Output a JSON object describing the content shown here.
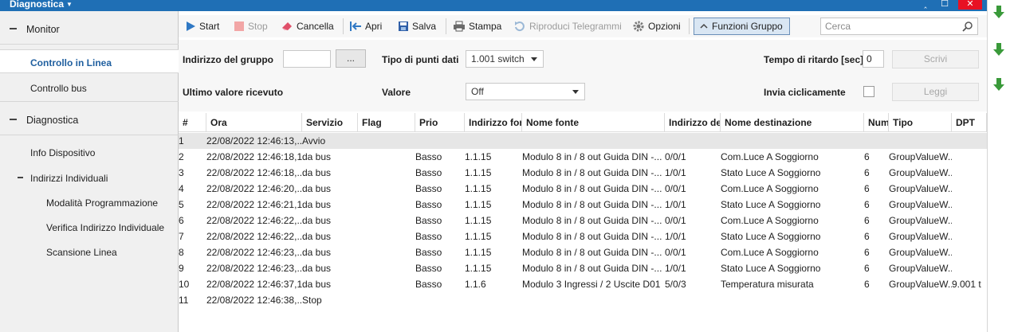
{
  "app": {
    "title": "Diagnostica"
  },
  "window_controls": {
    "minimize": "‸",
    "maximize": "☐",
    "close": "✕"
  },
  "sidebar": {
    "sections": [
      {
        "label": "Monitor"
      },
      {
        "label": "Diagnostica"
      }
    ],
    "items": [
      {
        "label": "Controllo in Linea"
      },
      {
        "label": "Controllo bus"
      },
      {
        "label": "Info Dispositivo"
      },
      {
        "label": "Indirizzi Individuali"
      },
      {
        "label": "Modalità Programmazione"
      },
      {
        "label": "Verifica Indirizzo Individuale"
      },
      {
        "label": "Scansione Linea"
      }
    ]
  },
  "toolbar": {
    "start": "Start",
    "stop": "Stop",
    "cancel": "Cancella",
    "open": "Apri",
    "save": "Salva",
    "print": "Stampa",
    "replay": "Riproduci Telegrammi",
    "options": "Opzioni",
    "group_functions": "Funzioni Gruppo",
    "search_placeholder": "Cerca"
  },
  "form": {
    "group_address_label": "Indirizzo del gruppo",
    "group_address_value": "",
    "browse_label": "...",
    "dpt_label": "Tipo di punti dati",
    "dpt_value": "1.001 switch",
    "delay_label": "Tempo di ritardo [sec]",
    "delay_value": "0",
    "write_label": "Scrivi",
    "last_value_label": "Ultimo valore ricevuto",
    "value_label": "Valore",
    "value_value": "Off",
    "cyclic_label": "Invia ciclicamente",
    "read_label": "Leggi"
  },
  "grid": {
    "columns": [
      "#",
      "Ora",
      "Servizio",
      "Flag",
      "Prio",
      "Indirizzo fonte",
      "Nome fonte",
      "Indirizzo destinazione",
      "Nome destinazione",
      "Num",
      "Tipo",
      "DPT"
    ],
    "rows": [
      [
        "1",
        "22/08/2022 12:46:13,...",
        "Avvio",
        "",
        "",
        "",
        "",
        "",
        "",
        "",
        "",
        ""
      ],
      [
        "2",
        "22/08/2022 12:46:18,1...",
        "da bus",
        "",
        "Basso",
        "1.1.15",
        "Modulo 8 in / 8 out Guida DIN -...",
        "0/0/1",
        "Com.Luce A Soggiorno",
        "6",
        "GroupValueW...",
        ""
      ],
      [
        "3",
        "22/08/2022 12:46:18,...",
        "da bus",
        "",
        "Basso",
        "1.1.15",
        "Modulo 8 in / 8 out Guida DIN -...",
        "1/0/1",
        "Stato Luce A Soggiorno",
        "6",
        "GroupValueW...",
        ""
      ],
      [
        "4",
        "22/08/2022 12:46:20,...",
        "da bus",
        "",
        "Basso",
        "1.1.15",
        "Modulo 8 in / 8 out Guida DIN -...",
        "0/0/1",
        "Com.Luce A Soggiorno",
        "6",
        "GroupValueW...",
        ""
      ],
      [
        "5",
        "22/08/2022 12:46:21,1...",
        "da bus",
        "",
        "Basso",
        "1.1.15",
        "Modulo 8 in / 8 out Guida DIN -...",
        "1/0/1",
        "Stato Luce A Soggiorno",
        "6",
        "GroupValueW...",
        ""
      ],
      [
        "6",
        "22/08/2022 12:46:22,...",
        "da bus",
        "",
        "Basso",
        "1.1.15",
        "Modulo 8 in / 8 out Guida DIN -...",
        "0/0/1",
        "Com.Luce A Soggiorno",
        "6",
        "GroupValueW...",
        ""
      ],
      [
        "7",
        "22/08/2022 12:46:22,...",
        "da bus",
        "",
        "Basso",
        "1.1.15",
        "Modulo 8 in / 8 out Guida DIN -...",
        "1/0/1",
        "Stato Luce A Soggiorno",
        "6",
        "GroupValueW...",
        ""
      ],
      [
        "8",
        "22/08/2022 12:46:23,...",
        "da bus",
        "",
        "Basso",
        "1.1.15",
        "Modulo 8 in / 8 out Guida DIN -...",
        "0/0/1",
        "Com.Luce A Soggiorno",
        "6",
        "GroupValueW...",
        ""
      ],
      [
        "9",
        "22/08/2022 12:46:23,...",
        "da bus",
        "",
        "Basso",
        "1.1.15",
        "Modulo 8 in / 8 out Guida DIN -...",
        "1/0/1",
        "Stato Luce A Soggiorno",
        "6",
        "GroupValueW...",
        ""
      ],
      [
        "10",
        "22/08/2022 12:46:37,1...",
        "da bus",
        "",
        "Basso",
        "1.1.6",
        "Modulo 3 Ingressi / 2 Uscite D01",
        "5/0/3",
        "Temperatura misurata",
        "6",
        "GroupValueW...",
        "9.001 t"
      ],
      [
        "11",
        "22/08/2022 12:46:38,...",
        "Stop",
        "",
        "",
        "",
        "",
        "",
        "",
        "",
        "",
        ""
      ]
    ]
  },
  "colors": {
    "accent": "#1f6fb5",
    "selected_text": "#1f5f9f",
    "arrow": "#3a9a3a"
  }
}
